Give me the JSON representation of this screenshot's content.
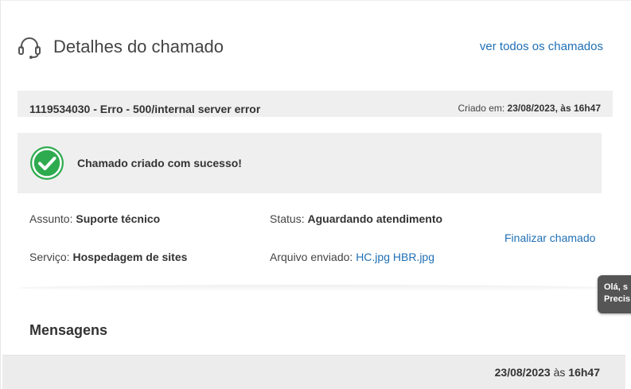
{
  "header": {
    "title": "Detalhes do chamado",
    "all_tickets_link": "ver todos os chamados",
    "icon": "headset-icon"
  },
  "ticket": {
    "title": "1119534030 - Erro - 500/internal server error",
    "created_label": "Criado em:",
    "created_date": "23/08/2023",
    "created_sep": ", às",
    "created_time": "16h47"
  },
  "success": {
    "icon": "check-circle-icon",
    "color": "#2eab4f",
    "message": "Chamado criado com sucesso!"
  },
  "details": {
    "subject_label": "Assunto:",
    "subject_value": "Suporte técnico",
    "status_label": "Status:",
    "status_value": "Aguardando atendimento",
    "service_label": "Serviço:",
    "service_value": "Hospedagem de sites",
    "file_label": "Arquivo enviado:",
    "files": [
      "HC.jpg",
      "HBR.jpg"
    ],
    "finalize_link": "Finalizar chamado"
  },
  "messages": {
    "title": "Mensagens",
    "date": "23/08/2023",
    "sep": "às",
    "time": "16h47"
  },
  "chat": {
    "line1": "Olá, s",
    "line2": "Precis"
  },
  "colors": {
    "link": "#1f6fb5",
    "panel_bg": "#efefef",
    "chat_bg": "#555555"
  }
}
